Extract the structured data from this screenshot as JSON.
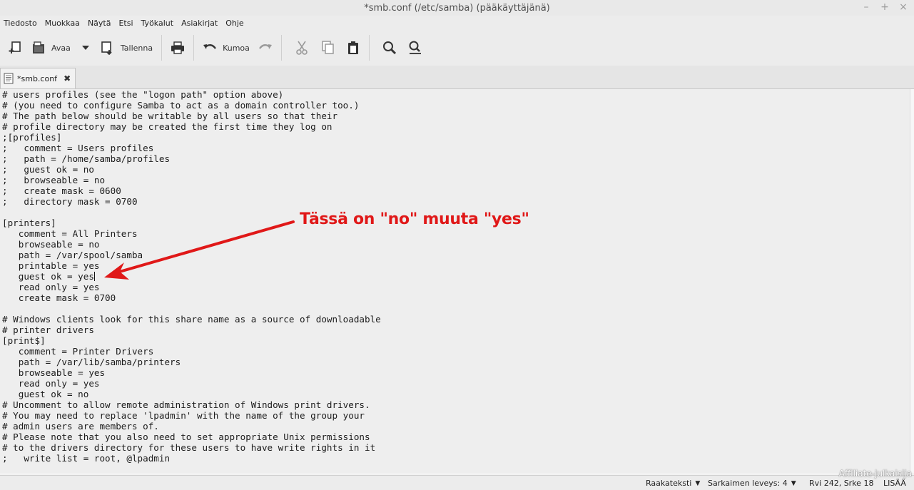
{
  "window": {
    "title": "*smb.conf (/etc/samba) (pääkäyttäjänä)",
    "controls": {
      "minimize": "–",
      "maximize": "+",
      "close": "×"
    }
  },
  "menu": [
    "Tiedosto",
    "Muokkaa",
    "Näytä",
    "Etsi",
    "Työkalut",
    "Asiakirjat",
    "Ohje"
  ],
  "toolbar": {
    "open_label": "Avaa",
    "save_label": "Tallenna",
    "undo_label": "Kumoa",
    "icons": [
      "new-document-icon",
      "open-icon",
      "dropdown-arrow-icon",
      "save-icon",
      "print-icon",
      "undo-icon",
      "redo-icon",
      "cut-icon",
      "copy-icon",
      "paste-icon",
      "search-icon",
      "search-replace-icon"
    ]
  },
  "tabs": [
    {
      "label": "*smb.conf",
      "close": "✖"
    }
  ],
  "editor": {
    "lines": [
      "# users profiles (see the \"logon path\" option above)",
      "# (you need to configure Samba to act as a domain controller too.)",
      "# The path below should be writable by all users so that their",
      "# profile directory may be created the first time they log on",
      ";[profiles]",
      ";   comment = Users profiles",
      ";   path = /home/samba/profiles",
      ";   guest ok = no",
      ";   browseable = no",
      ";   create mask = 0600",
      ";   directory mask = 0700",
      "",
      "[printers]",
      "   comment = All Printers",
      "   browseable = no",
      "   path = /var/spool/samba",
      "   printable = yes",
      "   guest ok = yes",
      "   read only = yes",
      "   create mask = 0700",
      "",
      "# Windows clients look for this share name as a source of downloadable",
      "# printer drivers",
      "[print$]",
      "   comment = Printer Drivers",
      "   path = /var/lib/samba/printers",
      "   browseable = yes",
      "   read only = yes",
      "   guest ok = no",
      "# Uncomment to allow remote administration of Windows print drivers.",
      "# You may need to replace 'lpadmin' with the name of the group your",
      "# admin users are members of.",
      "# Please note that you also need to set appropriate Unix permissions",
      "# to the drivers directory for these users to have write rights in it",
      ";   write list = root, @lpadmin"
    ],
    "caret_line": 17
  },
  "annotation": {
    "text": "Tässä on \"no\" muuta \"yes\"",
    "color": "#e01818"
  },
  "statusbar": {
    "language": "Raakateksti",
    "tab_width": "Sarkaimen leveys:  4",
    "position": "Rvi 242, Srke 18",
    "mode": "LISÄÄ"
  },
  "watermark": "Affiliate-julkaisija"
}
